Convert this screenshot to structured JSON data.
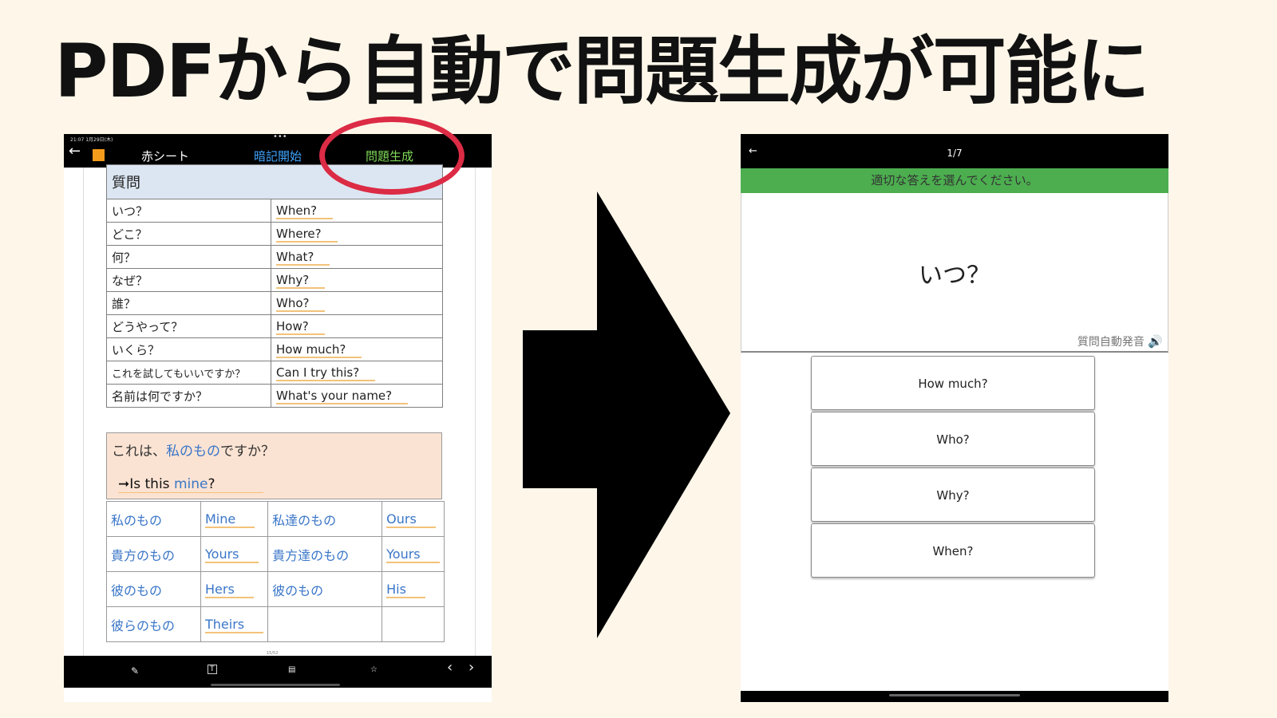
{
  "headline": "PDFから自動で問題生成が可能に",
  "left_app": {
    "status_time": "21:07  1月29日(木)",
    "status_dots": "•••",
    "toolbar": {
      "back": "←",
      "red_sheet": "赤シート",
      "memorize_start": "暗記開始",
      "generate_questions": "問題生成"
    },
    "question_table": {
      "header": "質問",
      "rows": [
        {
          "jp": "いつ？",
          "en": "When?"
        },
        {
          "jp": "どこ？",
          "en": "Where?"
        },
        {
          "jp": "何？",
          "en": "What?"
        },
        {
          "jp": "なぜ？",
          "en": "Why?"
        },
        {
          "jp": "誰？",
          "en": "Who?"
        },
        {
          "jp": "どうやって？",
          "en": "How?"
        },
        {
          "jp": "いくら？",
          "en": "How much?"
        },
        {
          "jp": "これを試してもいいですか？",
          "en": "Can I try this?"
        },
        {
          "jp": "名前は何ですか？",
          "en": "What's your name?"
        }
      ]
    },
    "mine_box": {
      "q_prefix": "これは、",
      "q_highlight": "私のもの",
      "q_suffix": "ですか？",
      "a_prefix": "➞Is this ",
      "a_highlight": "mine",
      "a_suffix": "?"
    },
    "pronoun_table": [
      [
        "私のもの",
        "Mine",
        "私達のもの",
        "Ours"
      ],
      [
        "貴方のもの",
        "Yours",
        "貴方達のもの",
        "Yours"
      ],
      [
        "彼のもの",
        "Hers",
        "彼のもの",
        "His"
      ],
      [
        "彼らのもの",
        "Theirs",
        "",
        ""
      ]
    ],
    "page_number": "15/52",
    "bottom_icons": [
      "✎",
      "T",
      "▤",
      "☆",
      "‹",
      "›"
    ]
  },
  "right_app": {
    "back": "←",
    "counter": "1/7",
    "instruction": "適切な答えを選んでください。",
    "question": "いつ？",
    "auto_speak": "質問自動発音",
    "speaker_icon": "🔊",
    "options": [
      "How much?",
      "Who?",
      "Why?",
      "When?"
    ]
  },
  "colors": {
    "background": "#fdf6e9",
    "memorize": "#3fa5ff",
    "generate": "#7ed957",
    "ring": "#dc2b45",
    "instruction_bar": "#4cae4f"
  }
}
